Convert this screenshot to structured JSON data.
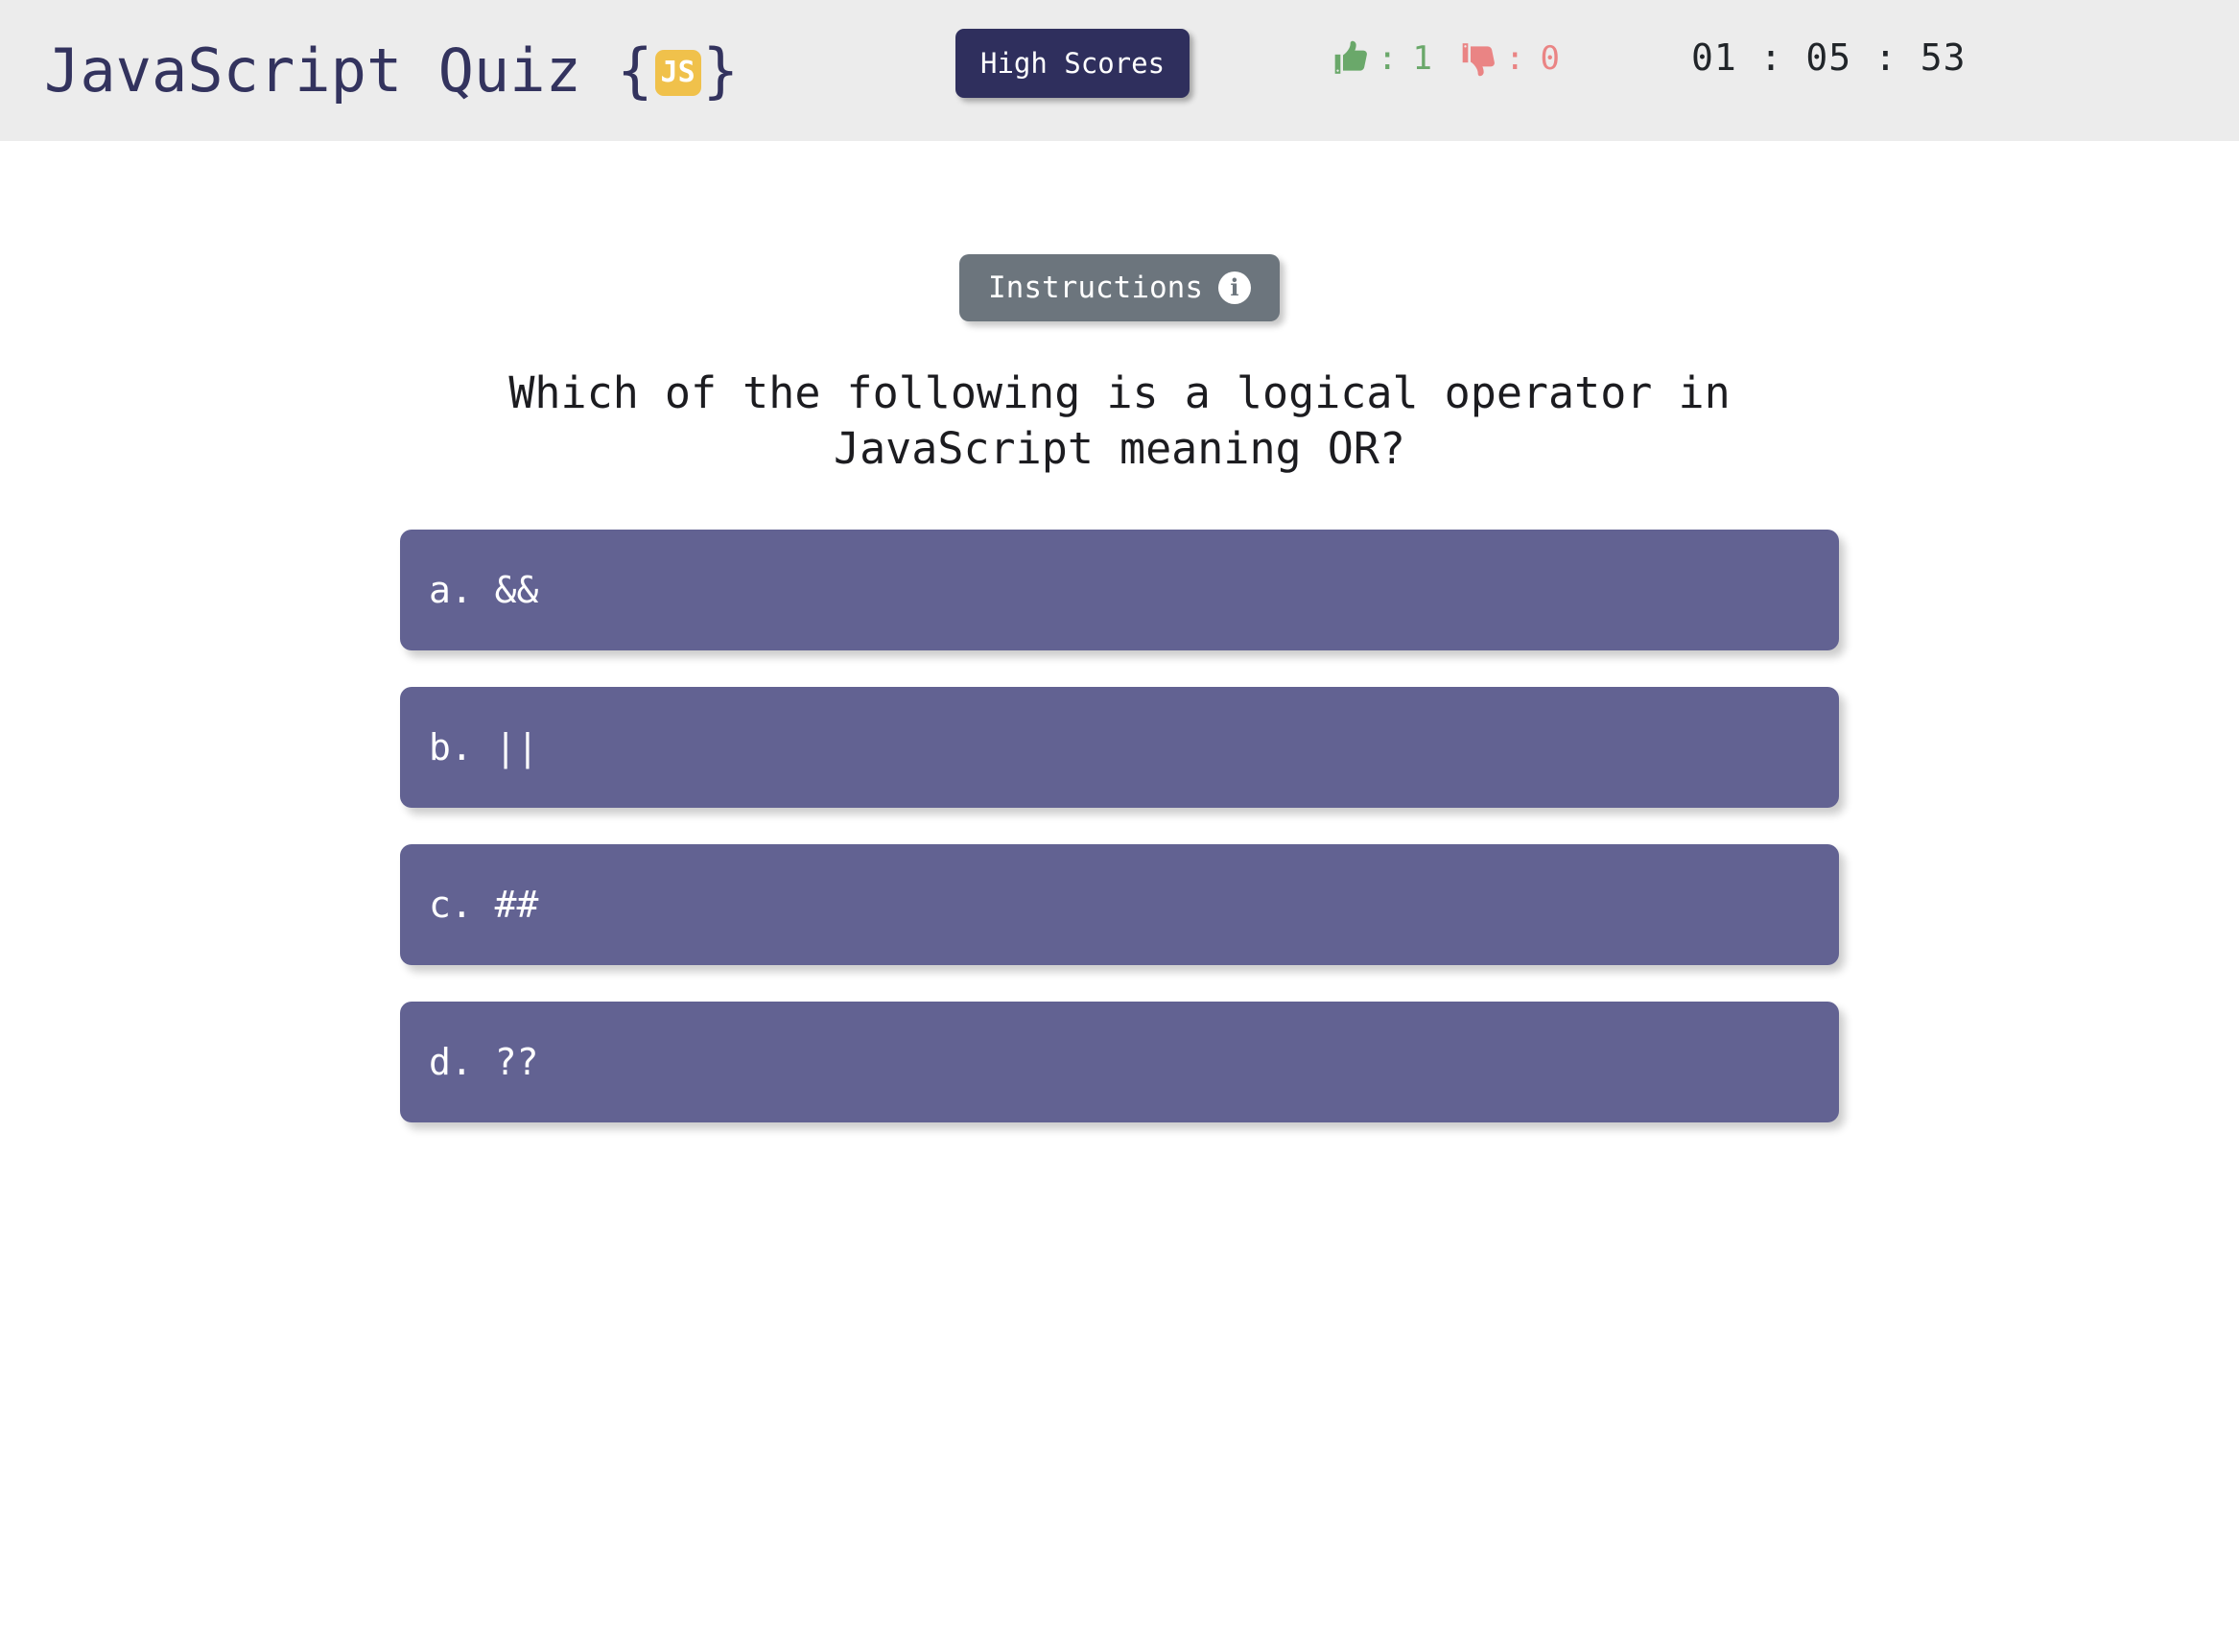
{
  "header": {
    "brand": {
      "title": "JavaScript Quiz",
      "brace_open": "{",
      "brace_close": "}",
      "badge_text": "JS",
      "badge_color": "#f0c14b",
      "title_color": "#33335e"
    },
    "high_scores_label": "High Scores",
    "high_scores_color": "#2f2f5d",
    "votes": {
      "up_icon": "thumbs-up-icon",
      "up_separator": ":",
      "up_count": "1",
      "up_color": "#6aa86a",
      "down_icon": "thumbs-down-icon",
      "down_separator": ":",
      "down_count": "0",
      "down_color": "#ea8484"
    },
    "timer": "01 : 05 : 53",
    "timer_color": "#212529",
    "background_color": "#ececec"
  },
  "main": {
    "instructions_label": "Instructions",
    "instructions_icon": "info-circle-icon",
    "instructions_icon_glyph": "i",
    "instructions_color": "#6c757d",
    "question": "Which of the following is a logical operator in JavaScript meaning OR?",
    "answers": [
      {
        "label": "a. &&"
      },
      {
        "label": "b. ||"
      },
      {
        "label": "c. ##"
      },
      {
        "label": "d. ??"
      }
    ],
    "answer_color": "#626292",
    "background_color": "#ffffff"
  }
}
